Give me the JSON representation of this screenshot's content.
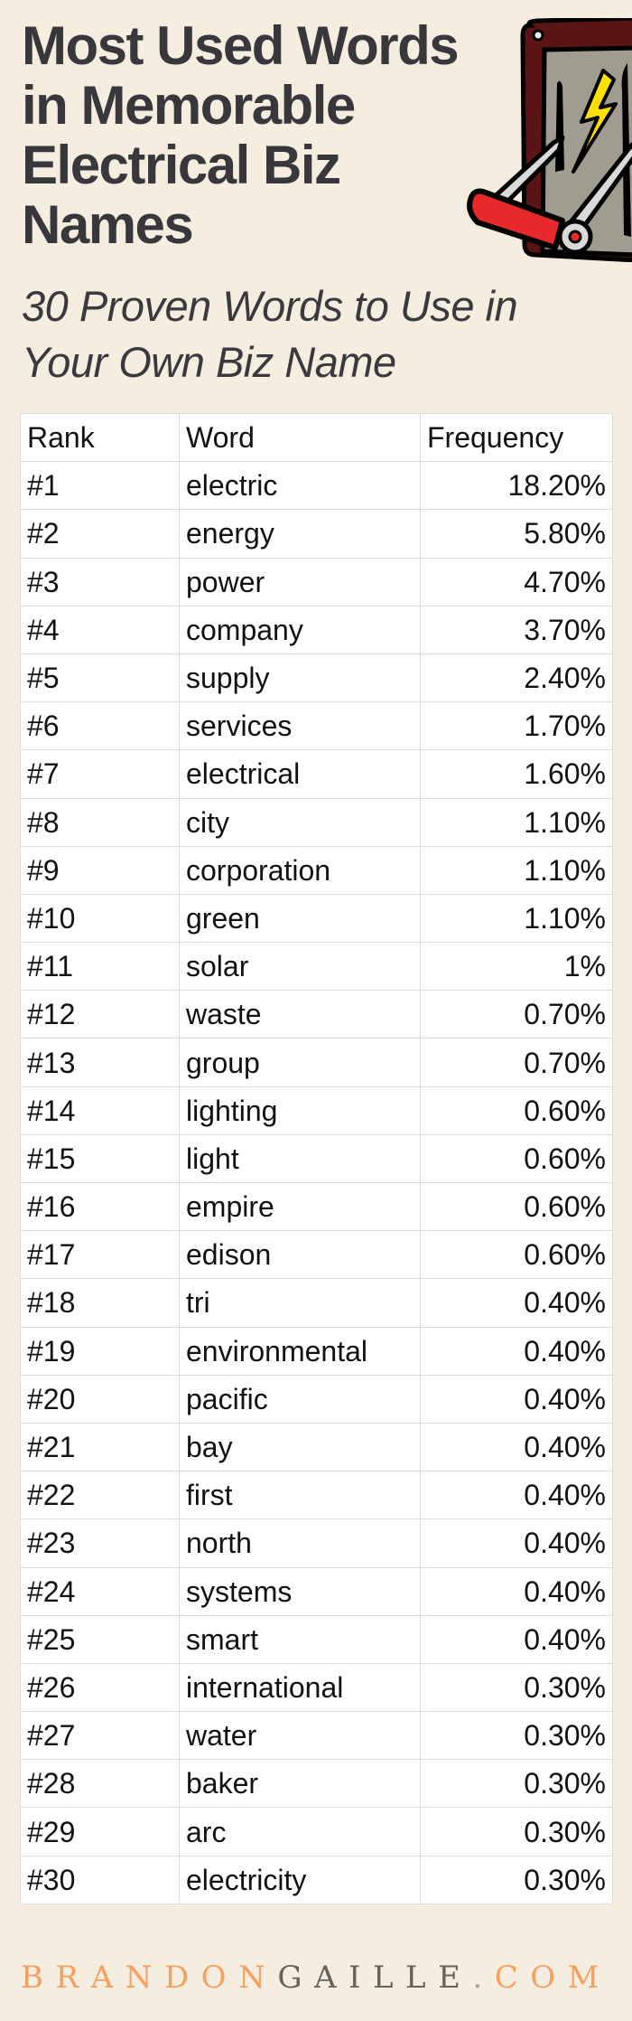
{
  "header": {
    "title_lines": [
      "Most Used Words",
      "in Memorable",
      "Electrical Biz",
      "Names"
    ],
    "subtitle_lines": [
      "30 Proven Words to Use in",
      "Your Own Biz Name"
    ],
    "illustration": "electrical-knife-switch-icon"
  },
  "colors": {
    "background": "#F5EDDF",
    "title_text": "#38373C",
    "brand_orange": "#F6A060",
    "brand_gray": "#66625C",
    "switch_frame": "#5A1414",
    "switch_panel": "#A09D90",
    "switch_handle": "#E8292B",
    "bolt": "#FFE000"
  },
  "table": {
    "headers": [
      "Rank",
      "Word",
      "Frequency"
    ],
    "rows": [
      {
        "rank": "#1",
        "word": "electric",
        "frequency": "18.20%"
      },
      {
        "rank": "#2",
        "word": "energy",
        "frequency": "5.80%"
      },
      {
        "rank": "#3",
        "word": "power",
        "frequency": "4.70%"
      },
      {
        "rank": "#4",
        "word": "company",
        "frequency": "3.70%"
      },
      {
        "rank": "#5",
        "word": "supply",
        "frequency": "2.40%"
      },
      {
        "rank": "#6",
        "word": "services",
        "frequency": "1.70%"
      },
      {
        "rank": "#7",
        "word": "electrical",
        "frequency": "1.60%"
      },
      {
        "rank": "#8",
        "word": "city",
        "frequency": "1.10%"
      },
      {
        "rank": "#9",
        "word": "corporation",
        "frequency": "1.10%"
      },
      {
        "rank": "#10",
        "word": "green",
        "frequency": "1.10%"
      },
      {
        "rank": "#11",
        "word": "solar",
        "frequency": "1%"
      },
      {
        "rank": "#12",
        "word": "waste",
        "frequency": "0.70%"
      },
      {
        "rank": "#13",
        "word": "group",
        "frequency": "0.70%"
      },
      {
        "rank": "#14",
        "word": "lighting",
        "frequency": "0.60%"
      },
      {
        "rank": "#15",
        "word": "light",
        "frequency": "0.60%"
      },
      {
        "rank": "#16",
        "word": "empire",
        "frequency": "0.60%"
      },
      {
        "rank": "#17",
        "word": "edison",
        "frequency": "0.60%"
      },
      {
        "rank": "#18",
        "word": "tri",
        "frequency": "0.40%"
      },
      {
        "rank": "#19",
        "word": "environmental",
        "frequency": "0.40%"
      },
      {
        "rank": "#20",
        "word": "pacific",
        "frequency": "0.40%"
      },
      {
        "rank": "#21",
        "word": "bay",
        "frequency": "0.40%"
      },
      {
        "rank": "#22",
        "word": "first",
        "frequency": "0.40%"
      },
      {
        "rank": "#23",
        "word": "north",
        "frequency": "0.40%"
      },
      {
        "rank": "#24",
        "word": "systems",
        "frequency": "0.40%"
      },
      {
        "rank": "#25",
        "word": "smart",
        "frequency": "0.40%"
      },
      {
        "rank": "#26",
        "word": "international",
        "frequency": "0.30%"
      },
      {
        "rank": "#27",
        "word": "water",
        "frequency": "0.30%"
      },
      {
        "rank": "#28",
        "word": "baker",
        "frequency": "0.30%"
      },
      {
        "rank": "#29",
        "word": "arc",
        "frequency": "0.30%"
      },
      {
        "rank": "#30",
        "word": "electricity",
        "frequency": "0.30%"
      }
    ]
  },
  "footer": {
    "brand_part1": "BRANDON",
    "brand_part2": "GAILLE",
    "brand_dot": ".",
    "brand_part3": "COM"
  }
}
